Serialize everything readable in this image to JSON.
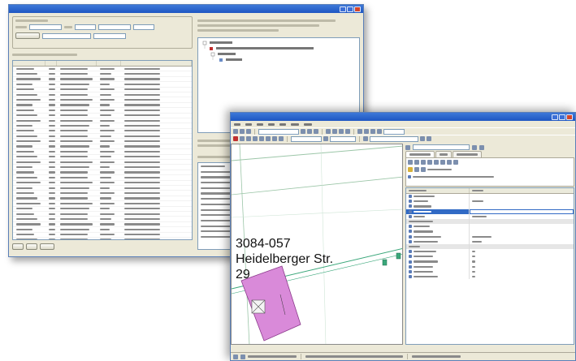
{
  "back_window": {
    "list_rows": 39
  },
  "front_window": {
    "map": {
      "parcel_label": "3084-057",
      "street_label": "Heidelberger Str.",
      "house_number": "29"
    },
    "colors": {
      "building_fill": "#d98ad9",
      "building_stroke": "#8b3a8b",
      "street_line": "#3aa77a",
      "parcel_line": "#9cc6a8",
      "selection": "#316ac5"
    }
  }
}
